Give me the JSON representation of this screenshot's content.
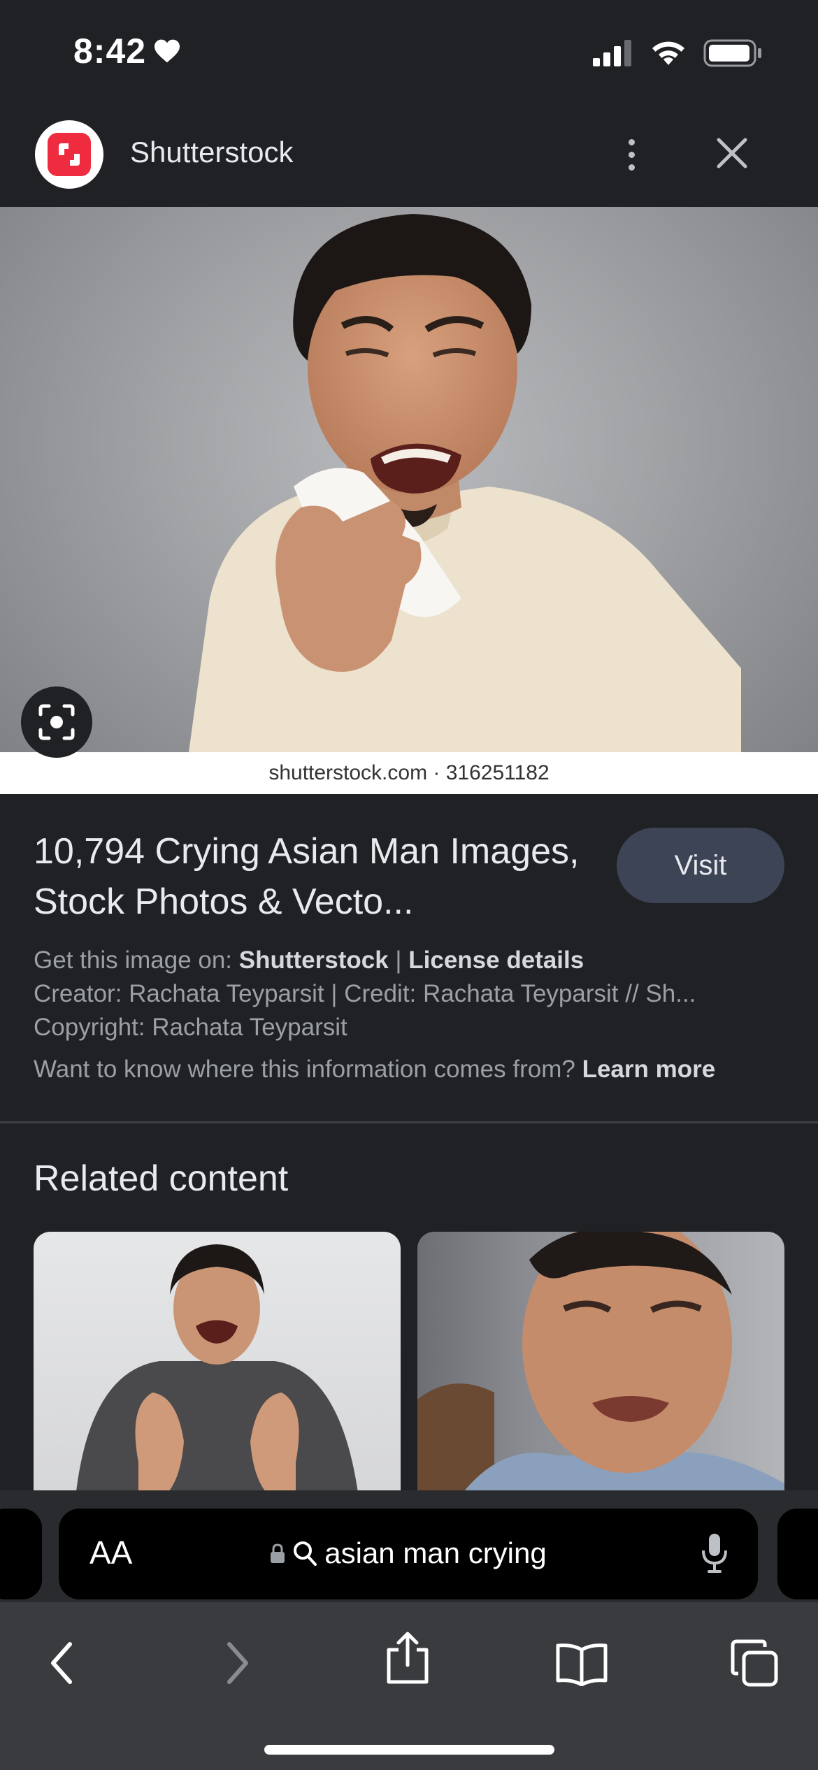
{
  "status_bar": {
    "time": "8:42",
    "icons": [
      "heart-icon",
      "cellular-signal-icon",
      "wifi-icon",
      "battery-icon"
    ]
  },
  "source": {
    "name": "Shutterstock",
    "logo_color": "#ee2b3f",
    "icons": [
      "more-vertical-icon",
      "close-icon"
    ]
  },
  "image": {
    "watermark": "shutterstock.com · 316251182",
    "lens_icon": "google-lens-icon"
  },
  "result": {
    "title": "10,794 Crying Asian Man Images, Stock Photos & Vecto...",
    "visit_label": "Visit",
    "get_image_prefix": "Get this image on: ",
    "get_image_source": "Shutterstock",
    "separator": " | ",
    "license_label": "License details",
    "creator_line": "Creator: Rachata Teyparsit | Credit: Rachata Teyparsit // Sh...",
    "copyright_line": "Copyright: Rachata Teyparsit",
    "info_question": "Want to know where this information comes from? ",
    "learn_more": "Learn more"
  },
  "related": {
    "title": "Related content"
  },
  "toolbar": {
    "aa_label": "AA",
    "search_query": "asian man crying",
    "icons": [
      "lock-icon",
      "search-icon",
      "microphone-icon",
      "back-icon",
      "forward-icon",
      "share-icon",
      "bookmarks-icon",
      "tabs-icon"
    ]
  },
  "colors": {
    "background": "#202124",
    "visit_button": "#3c4456",
    "text_primary": "#e8eaed",
    "text_secondary": "#9aa0a6"
  }
}
